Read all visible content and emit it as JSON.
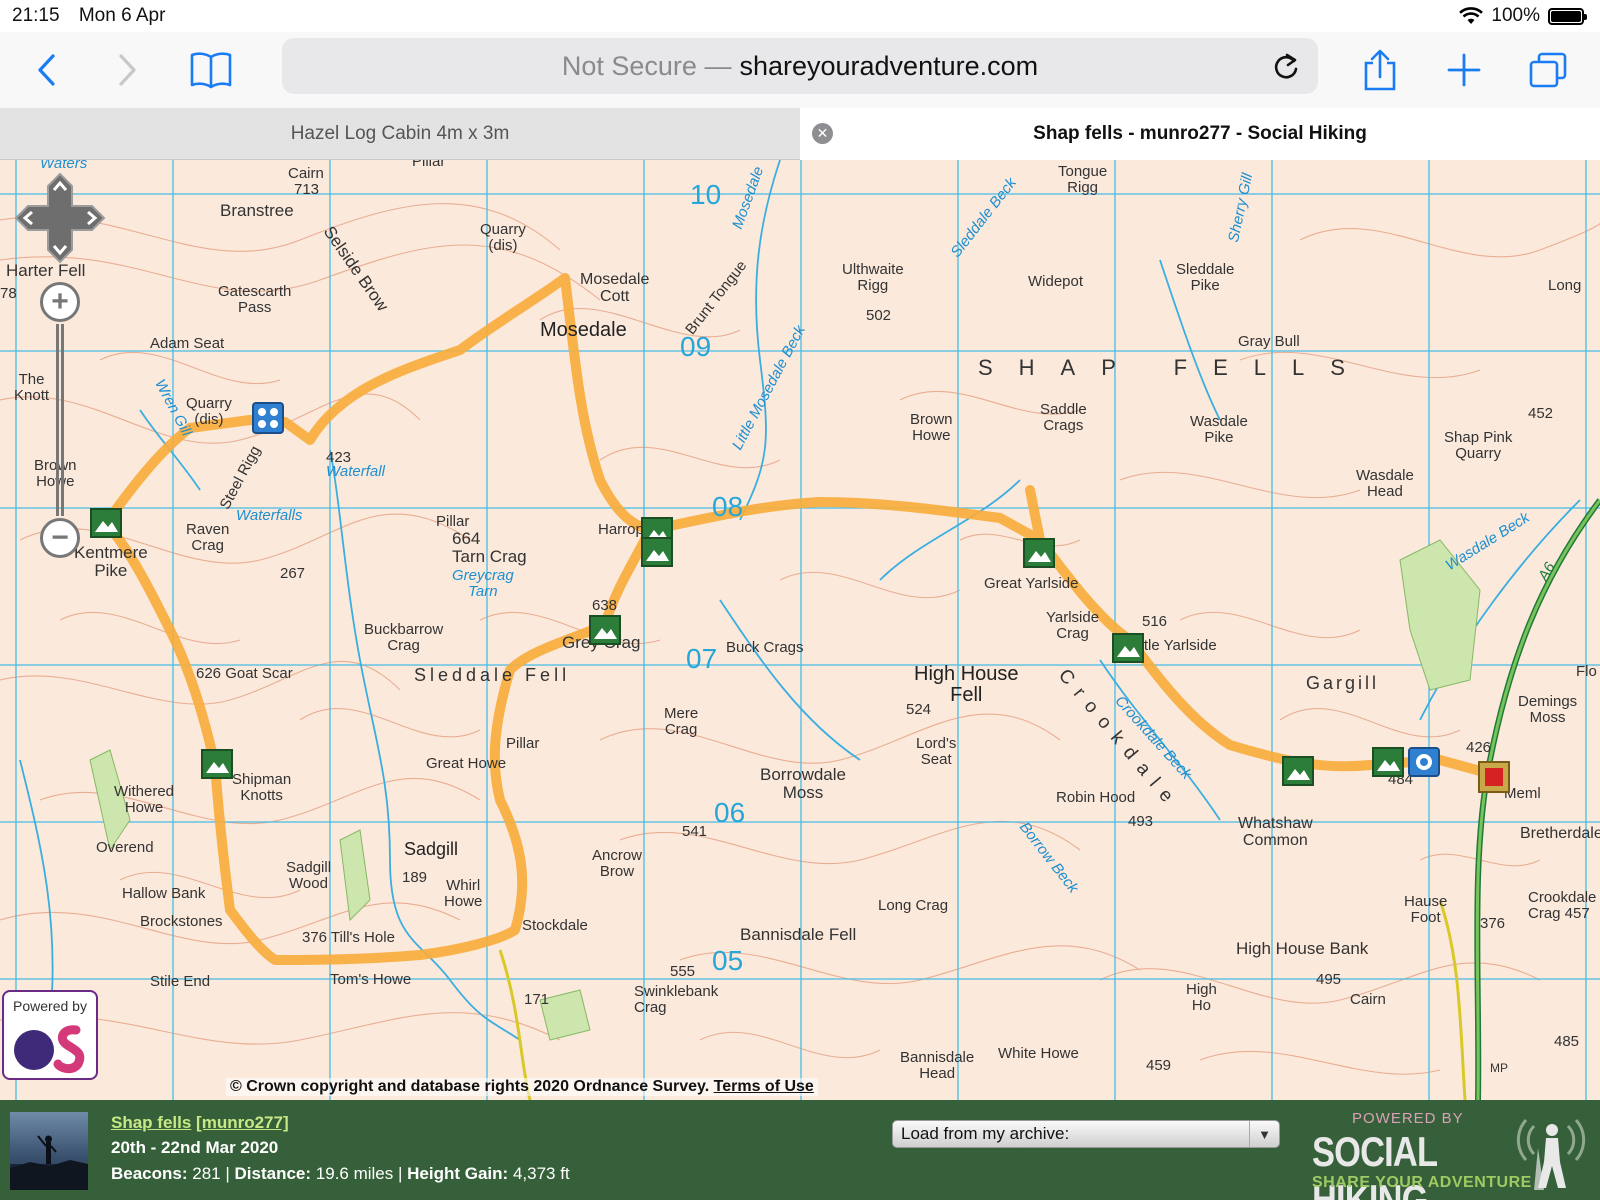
{
  "status_bar": {
    "time": "21:15",
    "date": "Mon 6 Apr",
    "battery": "100%"
  },
  "toolbar": {
    "address_insecure": "Not Secure —",
    "address_domain": "shareyouradventure.com"
  },
  "tabs": [
    {
      "title": "Hazel Log Cabin 4m x 3m",
      "active": false
    },
    {
      "title": "Shap fells - munro277 - Social Hiking",
      "active": true
    }
  ],
  "map": {
    "grid_labels": [
      "10",
      "09",
      "08",
      "07",
      "06",
      "05"
    ],
    "labels": {
      "cairn": "Cairn",
      "cairn_713": "713",
      "branstree": "Branstree",
      "pillar_top": "Pillar",
      "quarry_dis": "Quarry\n(dis)",
      "mosedale_cott": "Mosedale\nCott",
      "mosedale": "Mosedale",
      "brunt_tongue": "Brunt Tongue",
      "little_mosedale_beck": "Little Mosedale Beck",
      "harter_fell": "Harter Fell",
      "h78": "78",
      "gatescarth": "Gatescarth\nPass",
      "selside_brow": "Selside Brow",
      "adam_seat": "Adam Seat",
      "knott": "The\nKnott",
      "quarry_dis2": "Quarry\n(dis)",
      "h423": "423",
      "waterfall": "Waterfall",
      "steel_rigg": "Steel Rigg",
      "waterfalls": "Waterfalls",
      "brown_howe": "Brown\nHowe",
      "kentmere_pike": "Kentmere\nPike",
      "raven_crag": "Raven\nCrag",
      "pillar": "Pillar",
      "tarn_crag": "664\nTarn Crag",
      "greycrag_tarn": "Greycrag\nTarn",
      "h267": "267",
      "buckbarrow": "Buckbarrow\nCrag",
      "harrop": "Harrop",
      "h638": "638",
      "grey_crag": "Grey Crag",
      "goat_scar": "626 Goat Scar",
      "sleddale_fell": "Sleddale Fell",
      "g07": "07",
      "buck_crags": "Buck Crags",
      "mere_crag": "Mere\nCrag",
      "pillar2": "Pillar",
      "great_howe": "Great Howe",
      "withered_howe": "Withered\nHowe",
      "shipman_knotts": "Shipman\nKnotts",
      "overend": "Overend",
      "sadgill_wood": "Sadgill\nWood",
      "sadgill": "Sadgill",
      "h189": "189",
      "whirl_howe": "Whirl\nHowe",
      "hallow_bank": "Hallow Bank",
      "brockstones": "Brockstones",
      "tills_hole": "376 Till's Hole",
      "stockdale": "Stockdale",
      "ancrow_brow": "Ancrow\nBrow",
      "stile_end": "Stile End",
      "toms_howe": "Tom's Howe",
      "h171": "171",
      "h555": "555",
      "swinklebank": "Swinklebank\nCrag",
      "borrowdale_moss": "Borrowdale\nMoss",
      "h541": "541",
      "bannisdale_fell": "Bannisdale Fell",
      "long_crag": "Long Crag",
      "high_house_fell": "High House\nFell",
      "h524": "524",
      "lords_seat": "Lord's\nSeat",
      "crookdale": "Crookdale",
      "crookdale_beck": "Crookdale Beck",
      "robin_hood": "Robin Hood",
      "h493": "493",
      "borrow_beck": "Borrow Beck",
      "whatshaw": "Whatshaw\nCommon",
      "great_yarlside": "Great Yarlside",
      "yarlside_crag": "Yarlside\nCrag",
      "h516": "516",
      "little_yarlside": "Little Yarlside",
      "gargill": "Gargill",
      "demings_moss": "Demings\nMoss",
      "h426": "426",
      "h484": "484",
      "meml": "Meml",
      "bretherdale": "Bretherdale",
      "hause_foot": "Hause\nFoot",
      "h376": "376",
      "crookdale_crag": "Crookdale\nCrag 457",
      "high_house_bank": "High House Bank",
      "h495": "495",
      "cairn2": "Cairn",
      "high_ho": "High\nHo",
      "bannisdale_head": "Bannisdale\nHead",
      "white_howe": "White Howe",
      "h459": "459",
      "h485": "485",
      "mp": "MP",
      "tongue_rigg": "Tongue\nRigg",
      "ulthwaite_rigg": "Ulthwaite\nRigg",
      "h502": "502",
      "widepot": "Widepot",
      "sleddale_pike": "Sleddale\nPike",
      "long": "Long",
      "gray_bull": "Gray Bull",
      "shap_fells": "SHAP FELLS",
      "saddle_crags": "Saddle\nCrags",
      "wasdale_pike": "Wasdale\nPike",
      "shap_pink_quarry": "Shap Pink\nQuarry",
      "h452": "452",
      "wasdale_head": "Wasdale\nHead",
      "wasdale_beck": "Wasdale Beck",
      "a6": "A6",
      "sleddale_beck": "Sleddale Beck",
      "sherry_gill": "Sherry Gill",
      "mosedale_beck": "Mosedale",
      "wren_gill": "Wren Gill",
      "flo": "Flo",
      "waters": "Waters"
    },
    "copyright": "© Crown copyright and database rights 2020 Ordnance Survey.",
    "terms_link": "Terms of Use",
    "os_powered": "Powered by",
    "colors": {
      "route": "#f7ac3c",
      "grid": "#46bde6",
      "contour": "#e49a7a",
      "water": "#3aaee0",
      "beacon": "#2d7d3a"
    }
  },
  "footer": {
    "trip_title": "Shap fells",
    "trip_user": "[munro277]",
    "dates": "20th - 22nd Mar 2020",
    "beacons_label": "Beacons:",
    "beacons": "281",
    "distance_label": "Distance:",
    "distance": "19.6 miles",
    "height_label": "Height Gain:",
    "height": "4,373 ft",
    "archive_placeholder": "Load from my archive:",
    "logo_top": "POWERED BY",
    "logo_main": "SOCIAL HIKING",
    "logo_tag": "SHARE YOUR ADVENTURE"
  }
}
